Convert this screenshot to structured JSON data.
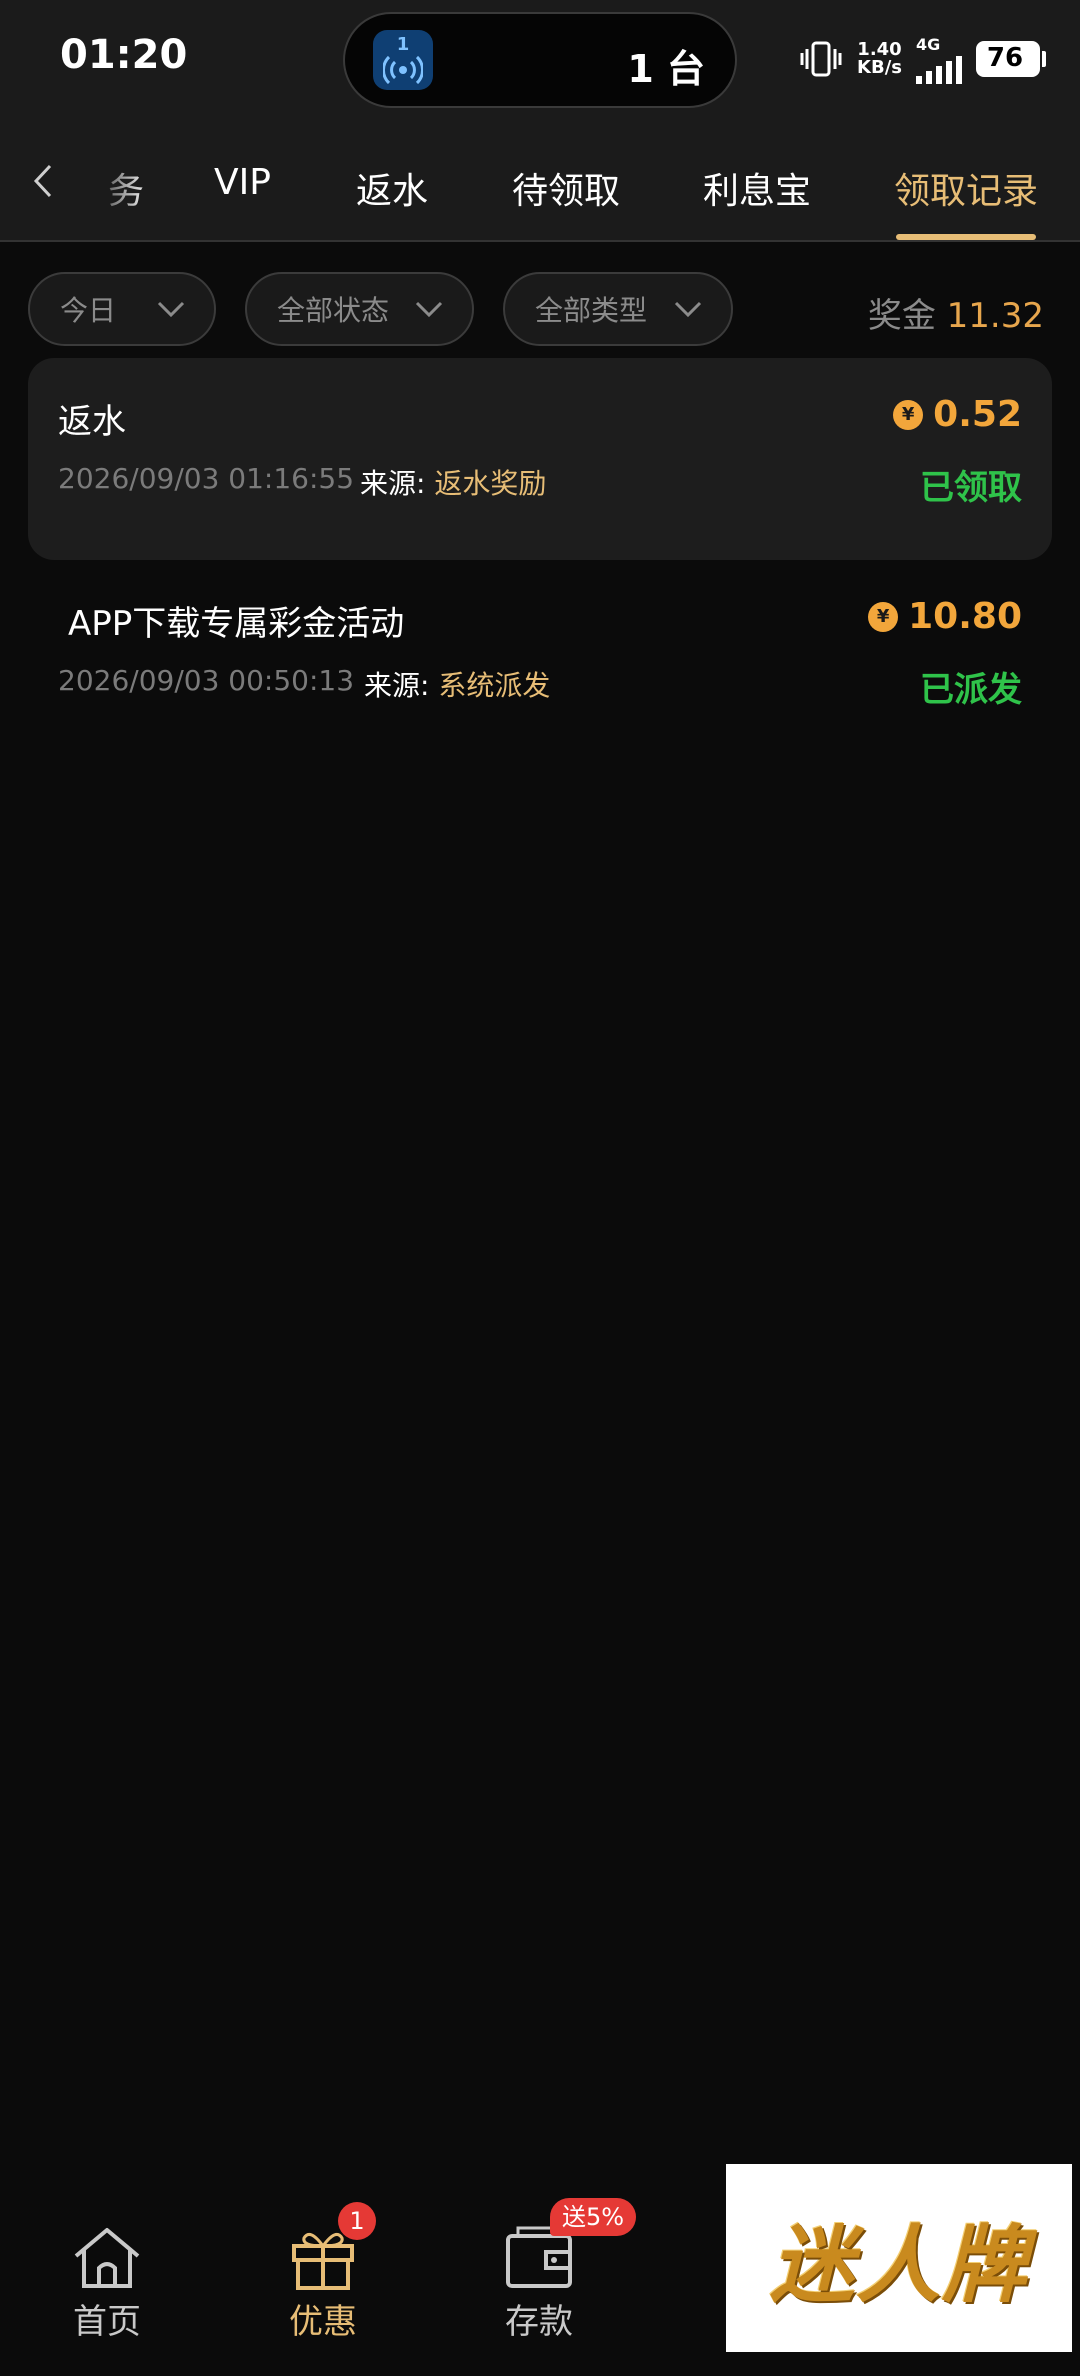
{
  "status_bar": {
    "time": "01:20",
    "island_app_number": "1",
    "island_text": "1 台",
    "net_speed_value": "1.40",
    "net_speed_unit": "KB/s",
    "network_type": "4G",
    "battery": "76"
  },
  "tabs": [
    {
      "label": "务"
    },
    {
      "label": "VIP"
    },
    {
      "label": "返水"
    },
    {
      "label": "待领取"
    },
    {
      "label": "利息宝"
    },
    {
      "label": "领取记录"
    }
  ],
  "filters": {
    "date": "今日",
    "status": "全部状态",
    "type": "全部类型"
  },
  "bonus": {
    "label": "奖金",
    "value": "11.32"
  },
  "records": [
    {
      "title": "返水",
      "amount": "0.52",
      "date": "2026/09/03 01:16:55",
      "source_label": "来源:",
      "source": "返水奖励",
      "status": "已领取"
    },
    {
      "title": "APP下载专属彩金活动",
      "amount": "10.80",
      "date": "2026/09/03 00:50:13",
      "source_label": "来源:",
      "source": "系统派发",
      "status": "已派发"
    }
  ],
  "currency_symbol": "¥",
  "bottom_nav": [
    {
      "label": "首页"
    },
    {
      "label": "优惠",
      "badge": "1"
    },
    {
      "label": "存款",
      "badge": "送5%"
    }
  ],
  "watermark": "迷人牌",
  "colors": {
    "accent_gold": "#e7bd76",
    "amount_orange": "#f2a63b",
    "status_green": "#2fc34a",
    "badge_red": "#e53935"
  }
}
